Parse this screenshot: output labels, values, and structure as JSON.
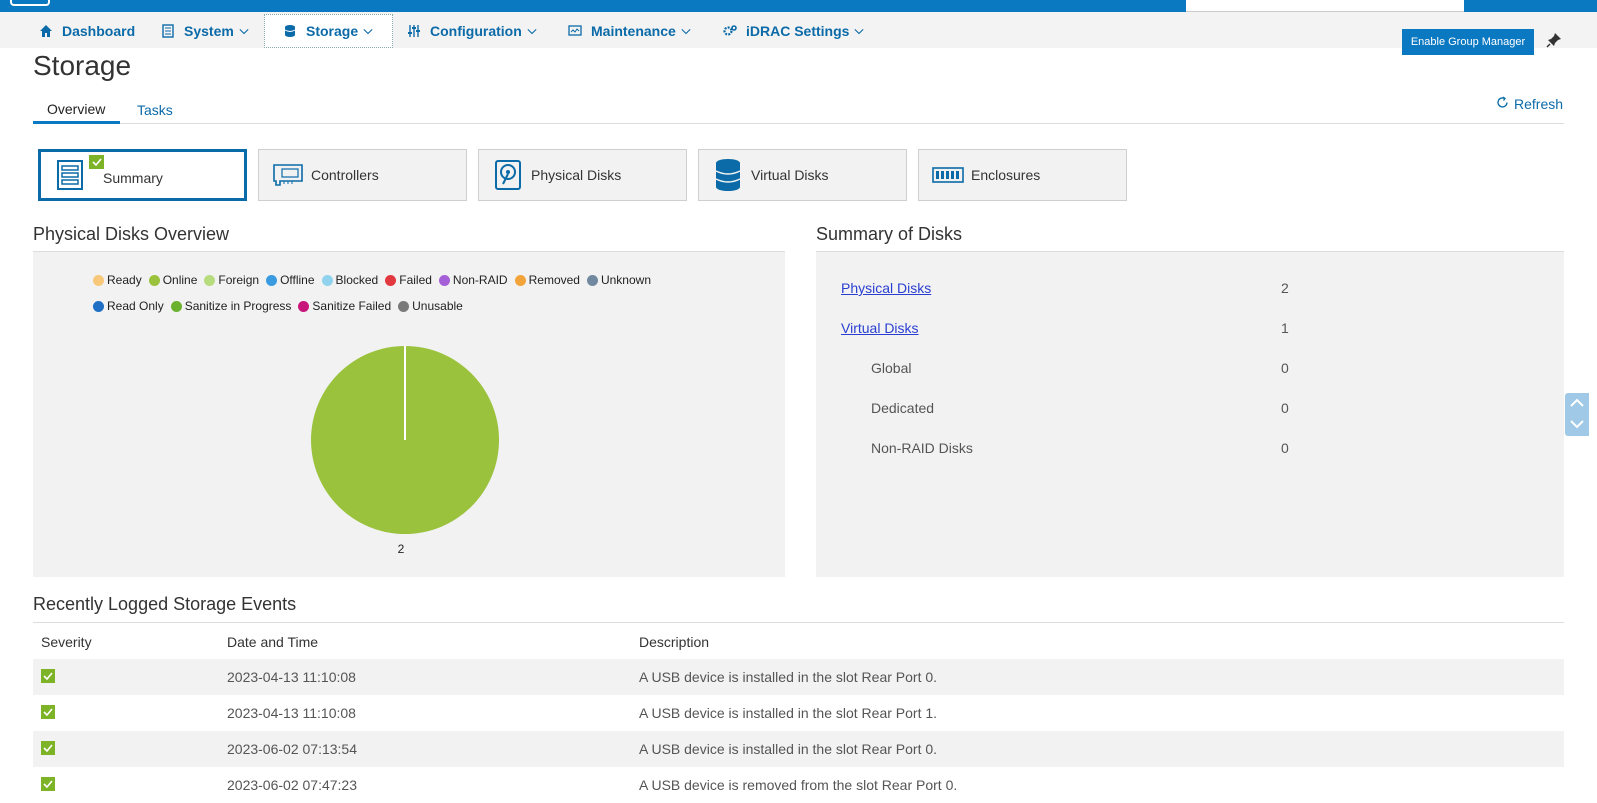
{
  "nav": {
    "items": [
      {
        "label": "Dashboard",
        "icon": "home-icon"
      },
      {
        "label": "System",
        "icon": "server-icon"
      },
      {
        "label": "Storage",
        "icon": "database-icon"
      },
      {
        "label": "Configuration",
        "icon": "sliders-icon"
      },
      {
        "label": "Maintenance",
        "icon": "monitor-icon"
      },
      {
        "label": "iDRAC Settings",
        "icon": "gears-icon"
      }
    ],
    "enable_group_manager": "Enable Group Manager"
  },
  "page": {
    "title": "Storage",
    "tabs": [
      "Overview",
      "Tasks"
    ],
    "refresh": "Refresh"
  },
  "tiles": [
    "Summary",
    "Controllers",
    "Physical Disks",
    "Virtual Disks",
    "Enclosures"
  ],
  "pd_overview": {
    "title": "Physical Disks Overview",
    "legend": [
      {
        "label": "Ready",
        "color": "#f7c87a"
      },
      {
        "label": "Online",
        "color": "#9ac23c"
      },
      {
        "label": "Foreign",
        "color": "#b7dc7d"
      },
      {
        "label": "Offline",
        "color": "#3a9be0"
      },
      {
        "label": "Blocked",
        "color": "#8fd3ef"
      },
      {
        "label": "Failed",
        "color": "#e2383f"
      },
      {
        "label": "Non-RAID",
        "color": "#a560d8"
      },
      {
        "label": "Removed",
        "color": "#f2a43a"
      },
      {
        "label": "Unknown",
        "color": "#7088a0"
      },
      {
        "label": "Read Only",
        "color": "#1f6fc5"
      },
      {
        "label": "Sanitize in Progress",
        "color": "#6cb22f"
      },
      {
        "label": "Sanitize Failed",
        "color": "#c8157a"
      },
      {
        "label": "Unusable",
        "color": "#7a7a7a"
      }
    ]
  },
  "chart_data": {
    "type": "pie",
    "slices": [
      {
        "label": "Online",
        "value": 2,
        "color": "#9ac23c"
      }
    ],
    "data_label": "2"
  },
  "summary": {
    "title": "Summary of Disks",
    "rows": [
      {
        "label": "Physical Disks",
        "value": "2"
      },
      {
        "label": "Virtual Disks",
        "value": "1"
      },
      {
        "label": "Global",
        "value": "0"
      },
      {
        "label": "Dedicated",
        "value": "0"
      },
      {
        "label": "Non-RAID Disks",
        "value": "0"
      }
    ]
  },
  "events": {
    "title": "Recently Logged Storage Events",
    "columns": [
      "Severity",
      "Date and Time",
      "Description"
    ],
    "rows": [
      {
        "date": "2023-04-13 11:10:08",
        "desc": "A USB device is installed in the slot Rear Port 0."
      },
      {
        "date": "2023-04-13 11:10:08",
        "desc": "A USB device is installed in the slot Rear Port 1."
      },
      {
        "date": "2023-06-02 07:13:54",
        "desc": "A USB device is installed in the slot Rear Port 0."
      },
      {
        "date": "2023-06-02 07:47:23",
        "desc": "A USB device is removed from the slot Rear Port 0."
      }
    ]
  }
}
